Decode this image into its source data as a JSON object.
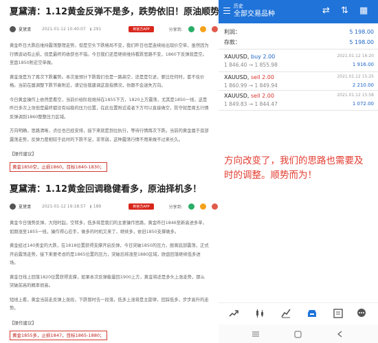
{
  "articles": [
    {
      "title": "夏黛清：1.12黄金反弹不是多，跌势依旧！原油顺势多！",
      "author": "夏黛清",
      "time": "2021-01-12 10:40:07",
      "views": "291",
      "app_button": "到官方APP",
      "share_label": "分享到:",
      "paragraphs": [
        "黄金昨日大跌后维持震荡整理走势，但是空头下跌格局不变，我们昨日也是连续给出现价空单，虽然因为行情波动有止损，但是最终的收获也不错。今日我们还是继续维持看跌思路不变，1860下反弹就是空。至盘1850附近空单做。",
        "黄金涨是为了再次下跌蓄势。本次虽预计下跌我们也是一路高空，还是是引述，要比任何时，套不住价格。当前在属调整下跌节奏附近，请记住我建调这直指情况，你跟不会迷失方向。",
        "今日黄金操作上依然是看空，当前价给阶段维持在1855下方，1820上方震荡，尤其是1850一线，这是昨日多次上攻但是最终都没有站稳的压力位置，在此位置附近或者下方可以直接做空，防守就是周五行情反弹调到1860整整压力区域。",
        "方向明确，思路清晰，点位也已经安排，接下来就是到位执行，等待行情再次下跌。当前的黄金属于底部震荡走势，反弹力度相较于此时的下跌不足，非常弱，这种震荡行情不用来做不过来长久。"
      ],
      "ops_label": "【操作建议】",
      "advice": "黄金1850空，止损1860，目标1840-1830；"
    },
    {
      "title": "夏黛清：1.12黄金回调稳健看多，原油择机多！",
      "author": "夏黛清",
      "time": "2021-01-12 19:18:57",
      "views": "189",
      "app_button": "到官方APP",
      "share_label": "分享到:",
      "paragraphs": [
        "黄金今日强势反弹，大阳时起，空转多，低多将是我们的主要操作思路，黄金昨日1846至新高进多单，如期涨至1855一线，操作得心应手，做多的时机又来了，继续多，依旧1850支撑做多。",
        "黄金经过140美金的大跌，在1818位置获得支撑开启反弹，今日突破1850的压力，脱离底部震荡，正式开启震荡走势，接下来要考虑的是1865位置的压力，突破后将涨至1880区域，欧盘回落继续低多进场。",
        "黄金日线上回落1820位置获得支撑，如果本次反弹能量回1900上方，黄金将还是多头上涨走势，那么突破前高的概率很高。",
        "短线上看，黄金当前走反弹上涨段，下跌暂时告一段落，低多上涨将是主旋律，回踩低多，步步高升的走势。"
      ],
      "ops_label": "【操作建议】",
      "advice": "黄金1855多，止损1847，目标1865-1880；"
    }
  ],
  "app": {
    "history_label": "历史",
    "subtitle": "全部交易品种",
    "profit_label": "利润：",
    "profit_value": "5 198.00",
    "deposit_label": "存款：",
    "deposit_value": "5 198.00",
    "deals": [
      {
        "symbol": "XAUUSD,",
        "side": "buy",
        "lots": "2.00",
        "open": "1 846.40",
        "close": "1 855.98",
        "time": "2021.01.12 16:20",
        "profit": "1 916.00"
      },
      {
        "symbol": "XAUUSD,",
        "side": "sell",
        "lots": "2.00",
        "open": "1 860.99",
        "close": "1 849.94",
        "time": "2021.01.12 15:25",
        "profit": "2 210.00"
      },
      {
        "symbol": "XAUUSD,",
        "side": "sell",
        "lots": "2.00",
        "open": "1 849.83",
        "close": "1 844.47",
        "time": "2021.01.12 15:58",
        "profit": "1 072.00"
      }
    ],
    "arrow": "→"
  },
  "note": [
    "方向改变了，我们的思路也需要及",
    "时的调整。顺势而为！"
  ],
  "colors": {
    "topbar": "#1f73d9",
    "buy": "#1a63c6",
    "sell": "#d7322c",
    "note": "#e23b2f",
    "advice_border": "#d23a2f"
  }
}
